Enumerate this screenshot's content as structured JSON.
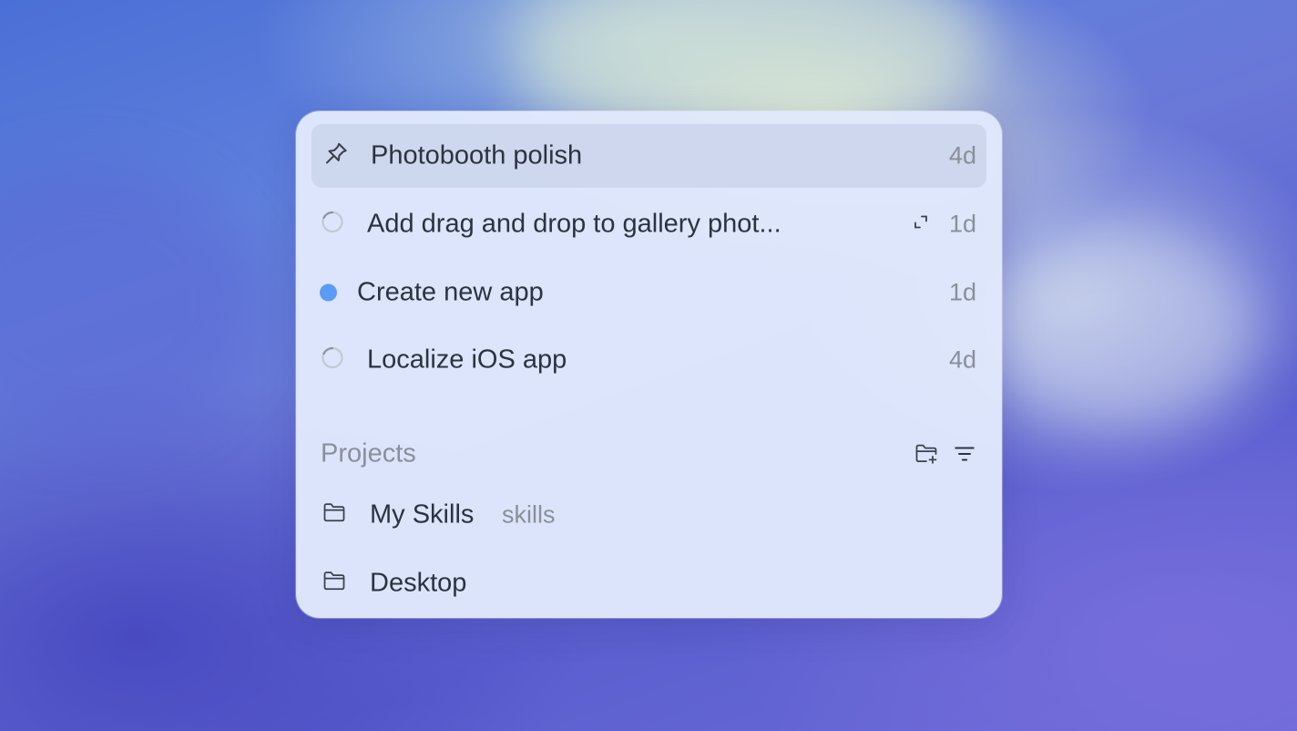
{
  "colors": {
    "status_blue": "#5a9bf5",
    "text_primary": "#2c3340",
    "text_muted": "#8a8f99",
    "selected_row": "#c8d2e8"
  },
  "threads": [
    {
      "title": "Photobooth polish",
      "age": "4d",
      "icon": "pin-icon",
      "selected": true
    },
    {
      "title": "Add drag and drop to gallery phot...",
      "age": "1d",
      "icon": "spinner-icon",
      "has_expand": true,
      "expand_icon": "expand-icon"
    },
    {
      "title": "Create new app",
      "age": "1d",
      "icon": "status-dot-icon"
    },
    {
      "title": "Localize iOS app",
      "age": "4d",
      "icon": "spinner-icon"
    }
  ],
  "projects_section": {
    "title": "Projects",
    "new_project_icon": "folder-plus-icon",
    "filter_icon": "filter-icon"
  },
  "projects": [
    {
      "name": "My Skills",
      "tag": "skills",
      "icon": "folder-icon"
    },
    {
      "name": "Desktop",
      "icon": "folder-icon"
    }
  ]
}
